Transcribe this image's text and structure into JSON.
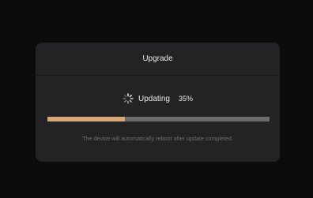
{
  "dialog": {
    "title": "Upgrade",
    "status_text": "Updating",
    "progress_percent_label": "35%",
    "progress_value": 0.35,
    "notice": "The device will automatically reboot after update completed.",
    "spinner_icon": "loading-spinner-icon"
  },
  "colors": {
    "background": "#0c0c0d",
    "dialog_background": "#232326",
    "progress_fill": "#d8a777",
    "progress_track": "#6b6b6b",
    "notice_text": "#6e6e72"
  }
}
